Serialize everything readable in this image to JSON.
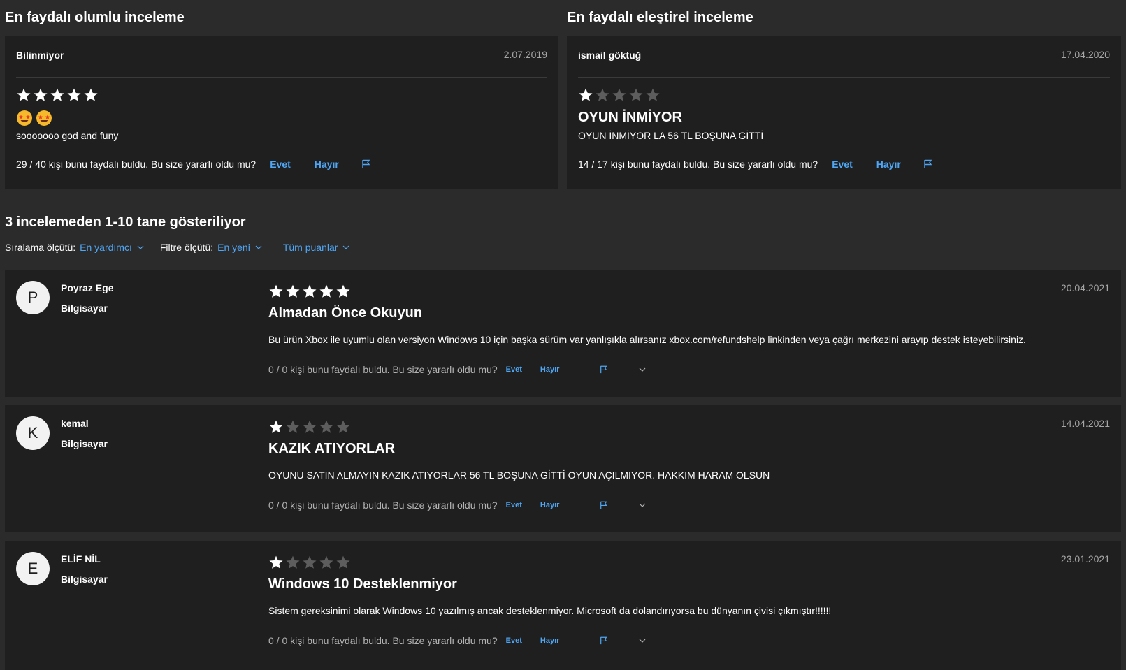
{
  "featured": {
    "positive": {
      "heading": "En faydalı olumlu inceleme",
      "author": "Bilinmiyor",
      "date": "2.07.2019",
      "rating": 5,
      "emojis": [
        "star-struck-emoji",
        "star-struck-emoji"
      ],
      "body": "sooooooo god and funy",
      "helpful_text": "29 / 40 kişi bunu faydalı buldu. Bu size yararlı oldu mu?",
      "yes_label": "Evet",
      "no_label": "Hayır"
    },
    "critical": {
      "heading": "En faydalı eleştirel inceleme",
      "author": "ismail göktuğ",
      "date": "17.04.2020",
      "rating": 1,
      "title": "OYUN İNMİYOR",
      "body": "OYUN İNMİYOR LA 56 TL BOŞUNA GİTTİ",
      "helpful_text": "14 / 17 kişi bunu faydalı buldu. Bu size yararlı oldu mu?",
      "yes_label": "Evet",
      "no_label": "Hayır"
    }
  },
  "list": {
    "heading": "3 incelemeden 1-10 tane gösteriliyor",
    "sort_label": "Sıralama ölçütü:",
    "sort_value": "En yardımcı",
    "filter_label": "Filtre ölçütü:",
    "filter_value": "En yeni",
    "rating_filter": "Tüm puanlar"
  },
  "reviews": [
    {
      "initial": "P",
      "name": "Poyraz Ege",
      "device": "Bilgisayar",
      "date": "20.04.2021",
      "rating": 5,
      "title": "Almadan Önce Okuyun",
      "body": "Bu ürün Xbox ile uyumlu olan versiyon Windows 10 için başka sürüm var yanlışıkla alırsanız xbox.com/refundshelp linkinden veya çağrı merkezini arayıp destek isteyebilirsiniz.",
      "helpful_text": "0 / 0 kişi bunu faydalı buldu. Bu size yararlı oldu mu?",
      "yes_label": "Evet",
      "no_label": "Hayır"
    },
    {
      "initial": "K",
      "name": "kemal",
      "device": "Bilgisayar",
      "date": "14.04.2021",
      "rating": 1,
      "title": "KAZIK ATIYORLAR",
      "body": "OYUNU SATIN ALMAYIN KAZIK ATIYORLAR 56 TL BOŞUNA GİTTİ OYUN AÇILMIYOR. HAKKIM HARAM OLSUN",
      "helpful_text": "0 / 0 kişi bunu faydalı buldu. Bu size yararlı oldu mu?",
      "yes_label": "Evet",
      "no_label": "Hayır"
    },
    {
      "initial": "E",
      "name": "ELİF NİL",
      "device": "Bilgisayar",
      "date": "23.01.2021",
      "rating": 1,
      "title": "Windows 10 Desteklenmiyor",
      "body": "Sistem gereksinimi olarak Windows 10 yazılmış ancak desteklenmiyor. Microsoft da dolandırıyorsa bu dünyanın çivisi çıkmıştır!!!!!!",
      "helpful_text": "0 / 0 kişi bunu faydalı buldu. Bu size yararlı oldu mu?",
      "yes_label": "Evet",
      "no_label": "Hayır"
    }
  ],
  "colors": {
    "star_filled": "#ffffff",
    "star_empty": "#5d5d5d",
    "link": "#4ea6f5",
    "card_bg": "#1f1f1f",
    "page_bg": "#2b2b2b"
  }
}
